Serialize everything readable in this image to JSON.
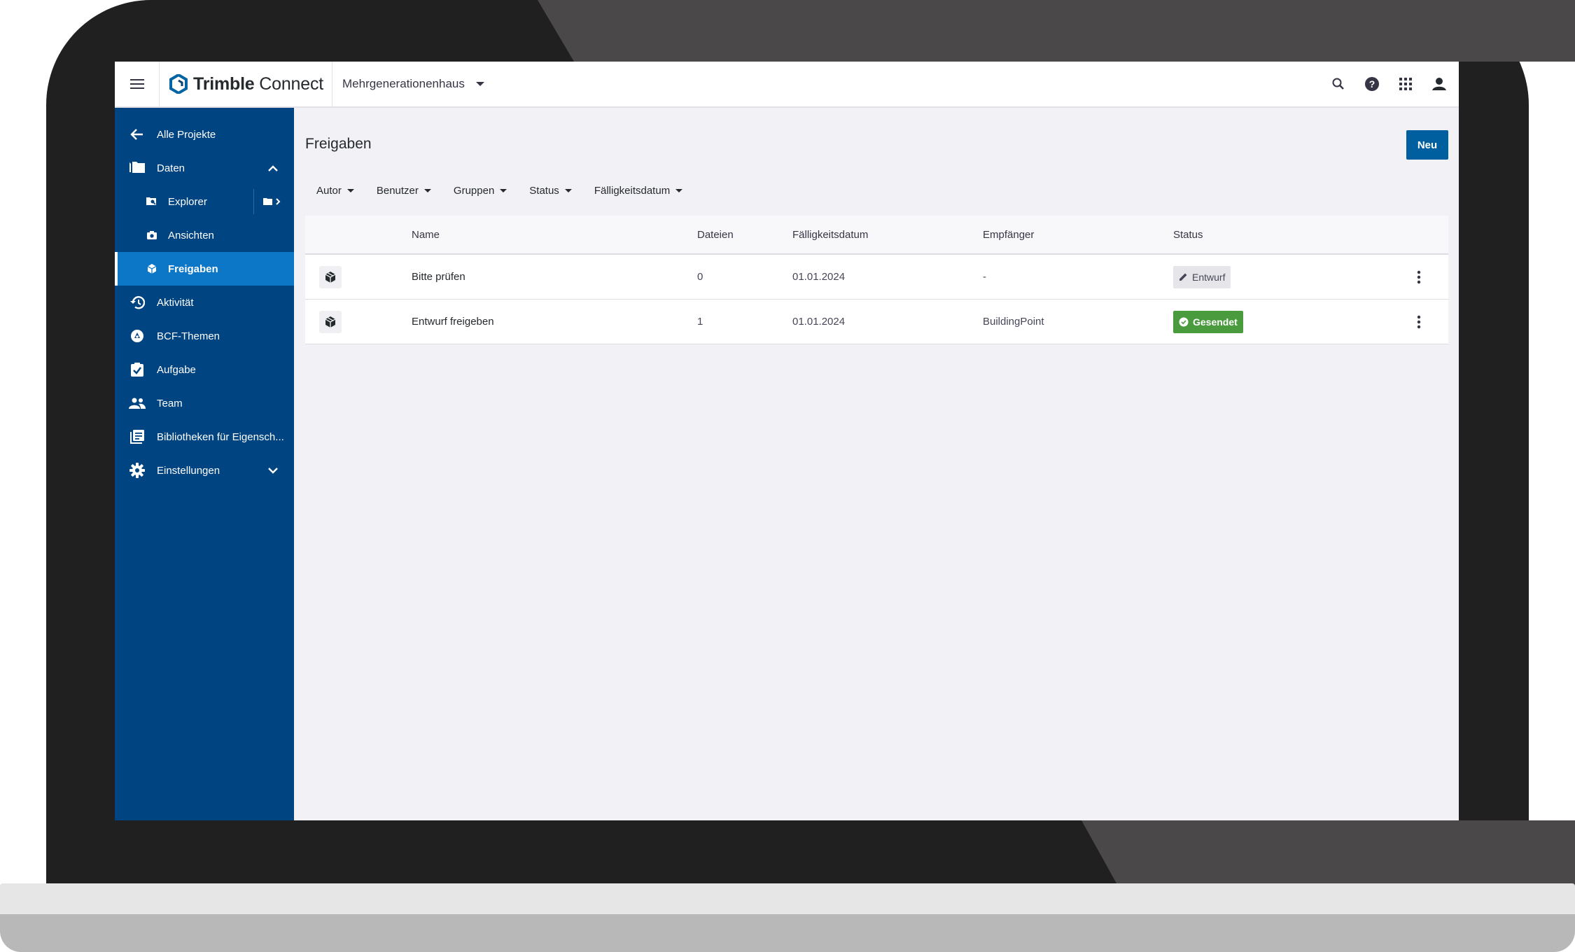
{
  "app": {
    "logo_bold": "Trimble",
    "logo_light": " Connect",
    "project_name": "Mehrgenerationenhaus"
  },
  "topbar_icons": [
    "menu-icon",
    "search-icon",
    "help-icon",
    "apps-grid-icon",
    "user-icon"
  ],
  "sidebar": {
    "items": [
      {
        "label": "Alle Projekte",
        "icon": "arrow-left-icon"
      },
      {
        "label": "Daten",
        "icon": "folder-icon",
        "expanded": true
      },
      {
        "label": "Explorer",
        "icon": "explorer-icon"
      },
      {
        "label": "Ansichten",
        "icon": "camera-icon"
      },
      {
        "label": "Freigaben",
        "icon": "package-icon",
        "active": true
      },
      {
        "label": "Aktivität",
        "icon": "history-icon"
      },
      {
        "label": "BCF-Themen",
        "icon": "bcf-icon"
      },
      {
        "label": "Aufgabe",
        "icon": "task-icon"
      },
      {
        "label": "Team",
        "icon": "team-icon"
      },
      {
        "label": "Bibliotheken für Eigensch...",
        "icon": "library-icon"
      },
      {
        "label": "Einstellungen",
        "icon": "gear-icon",
        "expanded": false
      }
    ]
  },
  "main": {
    "title": "Freigaben",
    "new_button": "Neu",
    "filters": [
      "Autor",
      "Benutzer",
      "Gruppen",
      "Status",
      "Fälligkeitsdatum"
    ],
    "table": {
      "columns": [
        "Name",
        "Dateien",
        "Fälligkeitsdatum",
        "Empfänger",
        "Status"
      ],
      "rows": [
        {
          "name": "Bitte prüfen",
          "files": "0",
          "due": "01.01.2024",
          "recipient": "-",
          "status": "Entwurf",
          "status_type": "draft"
        },
        {
          "name": "Entwurf freigeben",
          "files": "1",
          "due": "01.01.2024",
          "recipient": "BuildingPoint",
          "status": "Gesendet",
          "status_type": "sent"
        }
      ]
    }
  },
  "colors": {
    "sidebar": "#004482",
    "sidebar_active": "#0c77c6",
    "primary_button": "#005f9e",
    "status_sent": "#4a9a3e",
    "status_draft": "#e6e6ea"
  }
}
